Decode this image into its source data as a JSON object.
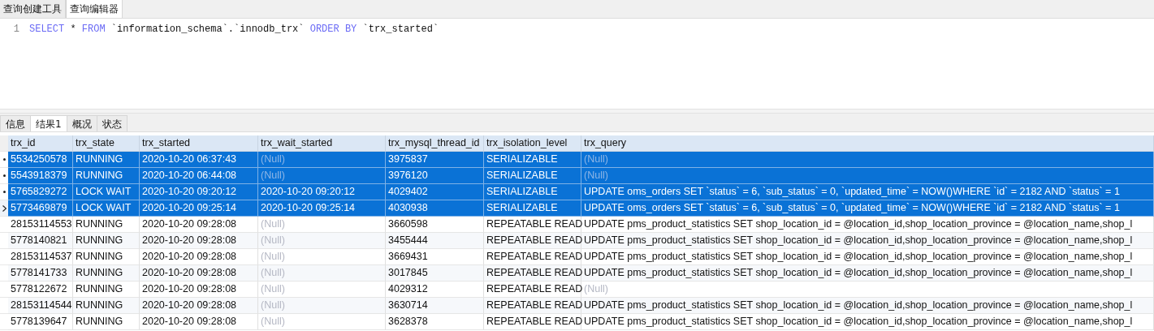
{
  "editor_tabs": [
    {
      "label": "查询创建工具",
      "selected": false
    },
    {
      "label": "查询编辑器",
      "selected": true
    }
  ],
  "editor": {
    "lines": [
      {
        "number": "1",
        "tokens": [
          {
            "kind": "keyword",
            "text": "SELECT"
          },
          {
            "kind": "plain",
            "text": " * "
          },
          {
            "kind": "keyword",
            "text": "FROM"
          },
          {
            "kind": "plain",
            "text": " `information_schema`.`innodb_trx` "
          },
          {
            "kind": "keyword",
            "text": "ORDER BY"
          },
          {
            "kind": "plain",
            "text": " `trx_started`"
          }
        ]
      }
    ]
  },
  "result_tabs": [
    {
      "label": "信息",
      "selected": false
    },
    {
      "label": "结果1",
      "selected": true
    },
    {
      "label": "概况",
      "selected": false
    },
    {
      "label": "状态",
      "selected": false
    }
  ],
  "table": {
    "columns": [
      "trx_id",
      "trx_state",
      "trx_started",
      "trx_wait_started",
      "trx_mysql_thread_id",
      "trx_isolation_level",
      "trx_query"
    ],
    "rows": [
      {
        "selected": true,
        "current": false,
        "cells": [
          "5534250578",
          "RUNNING",
          "2020-10-20 06:37:43",
          {
            "text": "(Null)",
            "null": true
          },
          "3975837",
          "SERIALIZABLE",
          {
            "text": "(Null)",
            "null": true
          }
        ]
      },
      {
        "selected": true,
        "current": false,
        "cells": [
          "5543918379",
          "RUNNING",
          "2020-10-20 06:44:08",
          {
            "text": "(Null)",
            "null": true
          },
          "3976120",
          "SERIALIZABLE",
          {
            "text": "(Null)",
            "null": true
          }
        ]
      },
      {
        "selected": true,
        "current": false,
        "cells": [
          "5765829272",
          "LOCK WAIT",
          "2020-10-20 09:20:12",
          "2020-10-20 09:20:12",
          "4029402",
          "SERIALIZABLE",
          "UPDATE oms_orders SET `status` = 6,    `sub_status` = 0,    `updated_time` = NOW()WHERE `id` = 2182 AND `status` = 1"
        ]
      },
      {
        "selected": true,
        "current": true,
        "cells": [
          "5773469879",
          "LOCK WAIT",
          "2020-10-20 09:25:14",
          "2020-10-20 09:25:14",
          "4030938",
          "SERIALIZABLE",
          "UPDATE oms_orders SET `status` = 6,    `sub_status` = 0,    `updated_time` = NOW()WHERE `id` = 2182 AND `status` = 1"
        ]
      },
      {
        "selected": false,
        "current": false,
        "cells": [
          "28153114553",
          "RUNNING",
          "2020-10-20 09:28:08",
          {
            "text": "(Null)",
            "null": true
          },
          "3660598",
          "REPEATABLE READ",
          "UPDATE pms_product_statistics SET shop_location_id =  @location_id,shop_location_province = @location_name,shop_l"
        ]
      },
      {
        "selected": false,
        "current": false,
        "cells": [
          "5778140821",
          "RUNNING",
          "2020-10-20 09:28:08",
          {
            "text": "(Null)",
            "null": true
          },
          "3455444",
          "REPEATABLE READ",
          "UPDATE pms_product_statistics SET shop_location_id =  @location_id,shop_location_province = @location_name,shop_l"
        ]
      },
      {
        "selected": false,
        "current": false,
        "cells": [
          "28153114537",
          "RUNNING",
          "2020-10-20 09:28:08",
          {
            "text": "(Null)",
            "null": true
          },
          "3669431",
          "REPEATABLE READ",
          "UPDATE pms_product_statistics SET shop_location_id =  @location_id,shop_location_province = @location_name,shop_l"
        ]
      },
      {
        "selected": false,
        "current": false,
        "cells": [
          "5778141733",
          "RUNNING",
          "2020-10-20 09:28:08",
          {
            "text": "(Null)",
            "null": true
          },
          "3017845",
          "REPEATABLE READ",
          "UPDATE pms_product_statistics SET shop_location_id =  @location_id,shop_location_province = @location_name,shop_l"
        ]
      },
      {
        "selected": false,
        "current": false,
        "cells": [
          "5778122672",
          "RUNNING",
          "2020-10-20 09:28:08",
          {
            "text": "(Null)",
            "null": true
          },
          "4029312",
          "REPEATABLE READ",
          {
            "text": "(Null)",
            "null": true
          }
        ]
      },
      {
        "selected": false,
        "current": false,
        "cells": [
          "28153114544",
          "RUNNING",
          "2020-10-20 09:28:08",
          {
            "text": "(Null)",
            "null": true
          },
          "3630714",
          "REPEATABLE READ",
          "UPDATE pms_product_statistics SET shop_location_id =  @location_id,shop_location_province = @location_name,shop_l"
        ]
      },
      {
        "selected": false,
        "current": false,
        "cells": [
          "5778139647",
          "RUNNING",
          "2020-10-20 09:28:08",
          {
            "text": "(Null)",
            "null": true
          },
          "3628378",
          "REPEATABLE READ",
          "UPDATE pms_product_statistics SET shop_location_id =  @location_id,shop_location_province = @location_name,shop_l"
        ]
      }
    ]
  }
}
